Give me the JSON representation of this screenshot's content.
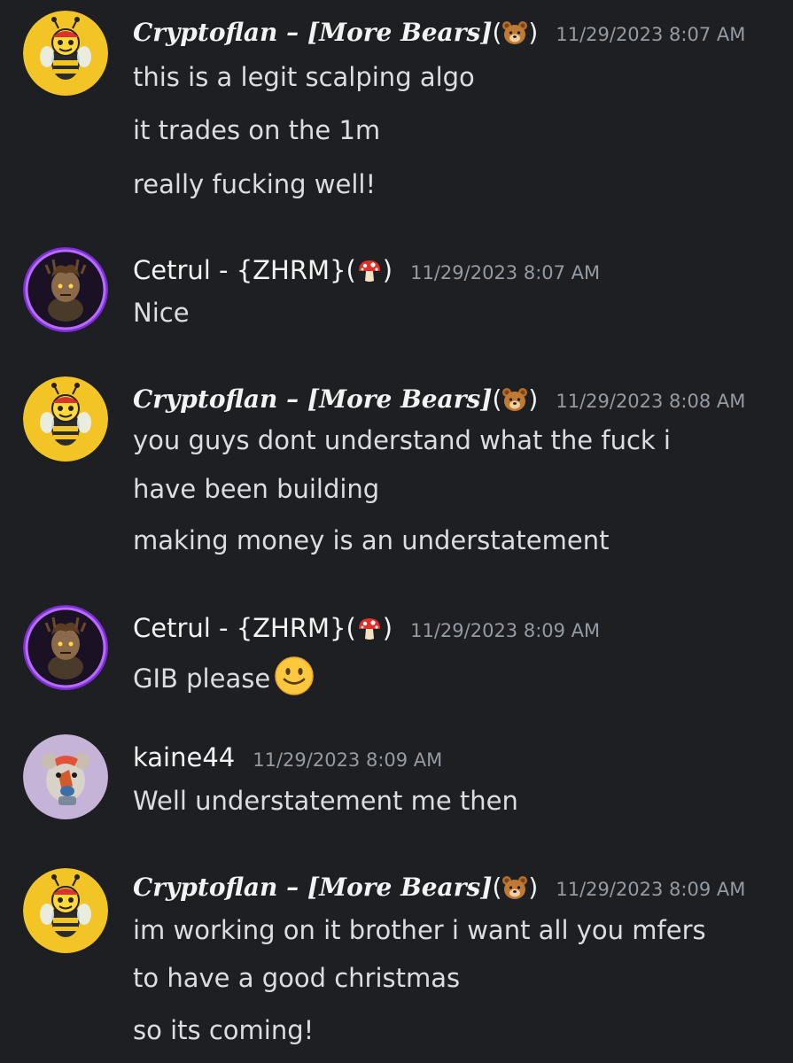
{
  "messages": [
    {
      "username": "Cryptoflan – [More Bears]",
      "emoji_icon": "bear-face-icon",
      "timestamp": "11/29/2023 8:07 AM",
      "lines": [
        "this is a legit scalping algo",
        "it trades on the 1m",
        "really fucking well!"
      ]
    },
    {
      "username": "Cetrul -  {ZHRM}",
      "emoji_icon": "mushroom-icon",
      "timestamp": "11/29/2023 8:07 AM",
      "lines": [
        "Nice"
      ]
    },
    {
      "username": "Cryptoflan – [More Bears]",
      "emoji_icon": "bear-face-icon",
      "timestamp": "11/29/2023 8:08 AM",
      "lines": [
        "you guys dont understand what the fuck i",
        "have been building",
        "making money is an understatement"
      ]
    },
    {
      "username": "Cetrul -  {ZHRM}",
      "emoji_icon": "mushroom-icon",
      "timestamp": "11/29/2023 8:09 AM",
      "lines": [
        "GIB please"
      ],
      "inline_emoji": "slightly-smiling-face-icon"
    },
    {
      "username": "kaine44",
      "timestamp": "11/29/2023 8:09 AM",
      "lines": [
        "Well understatement me then"
      ]
    },
    {
      "username": "Cryptoflan – [More Bears]",
      "emoji_icon": "bear-face-icon",
      "timestamp": "11/29/2023 8:09 AM",
      "lines": [
        "im working on it brother i want all you mfers",
        "to have a good christmas",
        "so its coming!"
      ]
    }
  ],
  "colors": {
    "background": "#1e1f22",
    "username": "#f2f3f5",
    "message_text": "#dbdee1",
    "timestamp": "#949ba4",
    "cetrul_avatar_ring": "#8a2be2"
  }
}
